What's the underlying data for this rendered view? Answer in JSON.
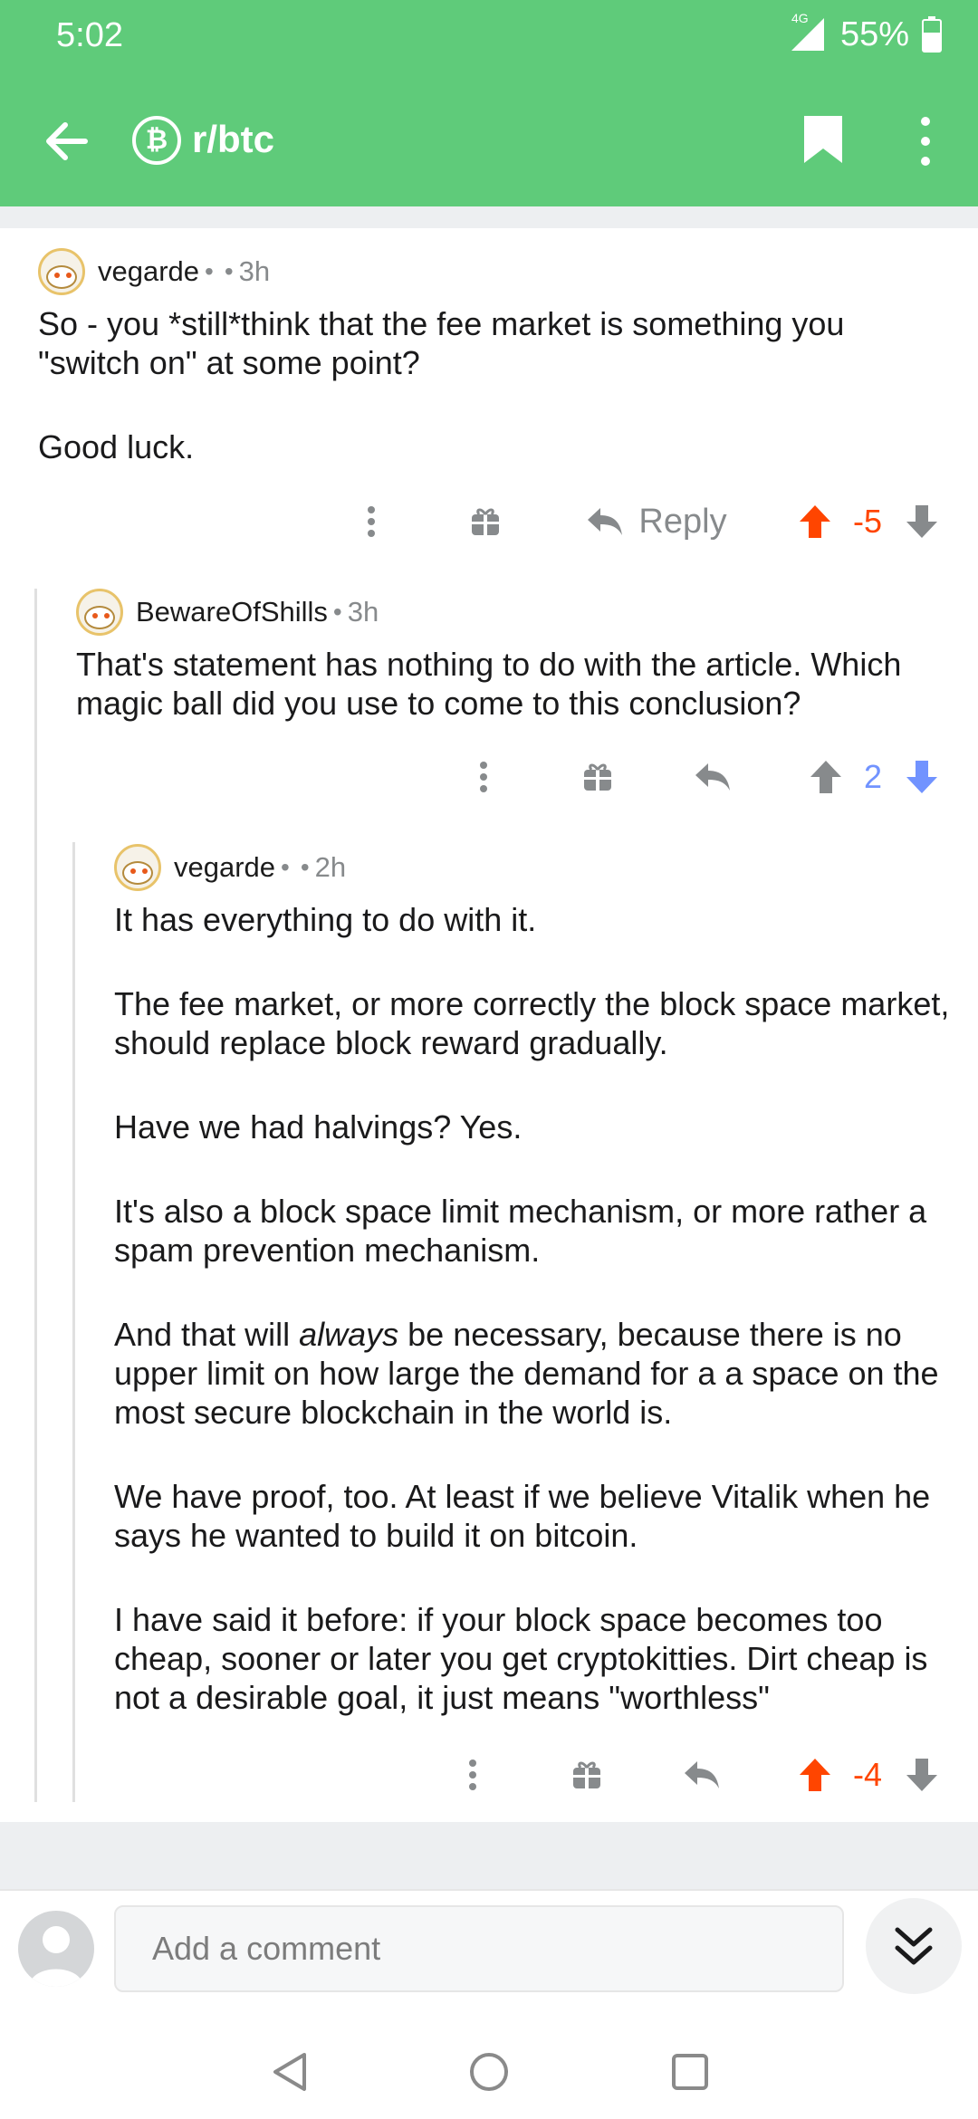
{
  "status_bar": {
    "time": "5:02",
    "network": "4G",
    "battery": "55%"
  },
  "toolbar": {
    "subreddit": "r/btc",
    "subreddit_icon_glyph": "₿"
  },
  "colors": {
    "header_green": "#5fcb7a",
    "upvote_orange": "#ff4500",
    "downvote_blue": "#7193ff",
    "neutral_gray": "#878a8c"
  },
  "comments": [
    {
      "author": "vegarde",
      "flair_dot": "•",
      "separator": "•",
      "age": "3h",
      "paragraphs": [
        "So - you *still*think that the fee market is something you \"switch on\" at some point?",
        "Good luck."
      ],
      "reply_label": "Reply",
      "score": "-5",
      "vote_state": "upvoted"
    },
    {
      "author": "BewareOfShills",
      "separator": "•",
      "age": "3h",
      "paragraphs": [
        "That's statement has nothing to do with the article. Which magic ball did you use to come to this conclusion?"
      ],
      "score": "2",
      "vote_state": "downvoted"
    },
    {
      "author": "vegarde",
      "flair_dot": "•",
      "separator": "•",
      "age": "2h",
      "paragraphs": [
        "It has everything to do with it.",
        "The fee market, or more correctly the block space market, should replace block reward gradually.",
        "Have we had halvings? Yes.",
        "It's also a block space limit mechanism, or more rather a spam prevention mechanism.",
        "We have proof, too. At least if we believe Vitalik when  he says he wanted to build it on bitcoin.",
        "I have said it before: if your block space becomes too cheap, sooner or later you get cryptokitties. Dirt cheap is not a desirable goal, it just means \"worthless\""
      ],
      "emph_paragraph": {
        "before": "And that will ",
        "emph": "always",
        "after": " be necessary, because there is no upper limit on how large the demand for a a space on the most secure blockchain in the world is."
      },
      "score": "-4",
      "vote_state": "upvoted"
    }
  ],
  "composer": {
    "placeholder": "Add a comment"
  },
  "icons": [
    "back-arrow-icon",
    "bitcoin-icon",
    "bookmark-icon",
    "more-vertical-icon",
    "gift-icon",
    "reply-icon",
    "upvote-icon",
    "downvote-icon",
    "double-chevron-down-icon",
    "nav-back-icon",
    "nav-home-icon",
    "nav-recents-icon"
  ]
}
